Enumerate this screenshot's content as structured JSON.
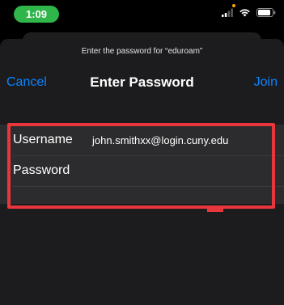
{
  "status_bar": {
    "time": "1:09",
    "time_pill_color": "#2fb54a",
    "icons": [
      "signal-icon",
      "wifi-icon",
      "battery-icon"
    ]
  },
  "dialog": {
    "prompt": "Enter the password for “eduroam”",
    "title": "Enter Password",
    "cancel_label": "Cancel",
    "join_label": "Join",
    "accent_color": "#0a84ff"
  },
  "form": {
    "username_label": "Username",
    "username_value": "john.smithxx@login.cuny.edu",
    "password_label": "Password",
    "password_value": ""
  },
  "annotation": {
    "highlight_color": "#e8363d"
  }
}
